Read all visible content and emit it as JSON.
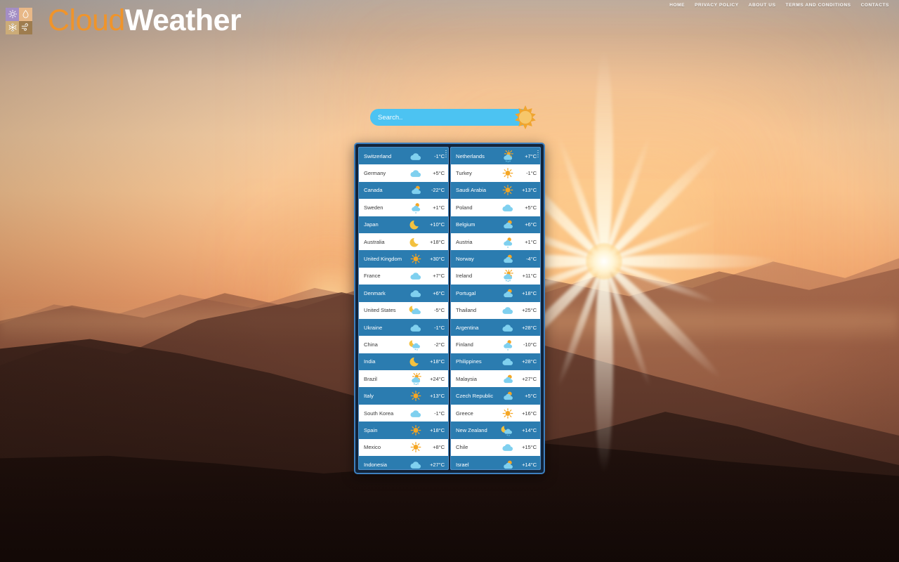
{
  "brand": {
    "part1": "Cloud",
    "part2": "Weather",
    "accent_color": "#f0942a"
  },
  "logo": {
    "cells": [
      {
        "name": "sun-icon",
        "color": "#a48ec4"
      },
      {
        "name": "droplet-icon",
        "color": "#e8b887"
      },
      {
        "name": "snowflake-icon",
        "color": "#ccac78"
      },
      {
        "name": "wind-icon",
        "color": "#9e7c4e"
      }
    ]
  },
  "nav": {
    "items": [
      {
        "label": "HOME"
      },
      {
        "label": "PRIVACY POLICY"
      },
      {
        "label": "ABOUT US"
      },
      {
        "label": "TERMS AND CONDITIONS"
      },
      {
        "label": "CONTACTS"
      }
    ]
  },
  "search": {
    "placeholder": "Search..",
    "value": "",
    "button_icon": "sun-icon",
    "field_color": "#4cc3f2",
    "button_color": "#f2a93b"
  },
  "panel": {
    "border_color": "#3d7fbf",
    "background_color": "#12243a",
    "row_odd_color": "#2b7cb0",
    "row_even_color": "#ffffff",
    "left_column": [
      {
        "country": "Switzerland",
        "temp": "-1°C",
        "icon": "cloud"
      },
      {
        "country": "Germany",
        "temp": "+5°C",
        "icon": "cloud"
      },
      {
        "country": "Canada",
        "temp": "-22°C",
        "icon": "sun-cloud"
      },
      {
        "country": "Sweden",
        "temp": "+1°C",
        "icon": "sun-cloud-snow"
      },
      {
        "country": "Japan",
        "temp": "+10°C",
        "icon": "moon"
      },
      {
        "country": "Australia",
        "temp": "+18°C",
        "icon": "moon"
      },
      {
        "country": "United Kingdom",
        "temp": "+30°C",
        "icon": "sun"
      },
      {
        "country": "France",
        "temp": "+7°C",
        "icon": "cloud"
      },
      {
        "country": "Denmark",
        "temp": "+6°C",
        "icon": "cloud"
      },
      {
        "country": "United States",
        "temp": "-5°C",
        "icon": "moon-cloud"
      },
      {
        "country": "Ukraine",
        "temp": "-1°C",
        "icon": "cloud"
      },
      {
        "country": "China",
        "temp": "-2°C",
        "icon": "moon-cloud-rain"
      },
      {
        "country": "India",
        "temp": "+18°C",
        "icon": "moon"
      },
      {
        "country": "Brazil",
        "temp": "+24°C",
        "icon": "sun-cloud-rain"
      },
      {
        "country": "Italy",
        "temp": "+13°C",
        "icon": "sun"
      },
      {
        "country": "South Korea",
        "temp": "-1°C",
        "icon": "cloud"
      },
      {
        "country": "Spain",
        "temp": "+18°C",
        "icon": "sun"
      },
      {
        "country": "Mexico",
        "temp": "+8°C",
        "icon": "sun"
      },
      {
        "country": "Indonesia",
        "temp": "+27°C",
        "icon": "cloud"
      }
    ],
    "right_column": [
      {
        "country": "Netherlands",
        "temp": "+7°C",
        "icon": "sun-cloud-rain"
      },
      {
        "country": "Turkey",
        "temp": "-1°C",
        "icon": "sun"
      },
      {
        "country": "Saudi Arabia",
        "temp": "+13°C",
        "icon": "sun"
      },
      {
        "country": "Poland",
        "temp": "+5°C",
        "icon": "cloud"
      },
      {
        "country": "Belgium",
        "temp": "+6°C",
        "icon": "sun-cloud"
      },
      {
        "country": "Austria",
        "temp": "+1°C",
        "icon": "sun-cloud-snow"
      },
      {
        "country": "Norway",
        "temp": "-4°C",
        "icon": "sun-cloud"
      },
      {
        "country": "Ireland",
        "temp": "+11°C",
        "icon": "sun-cloud-rain"
      },
      {
        "country": "Portugal",
        "temp": "+18°C",
        "icon": "sun-cloud"
      },
      {
        "country": "Thailand",
        "temp": "+25°C",
        "icon": "cloud"
      },
      {
        "country": "Argentina",
        "temp": "+28°C",
        "icon": "cloud"
      },
      {
        "country": "Finland",
        "temp": "-10°C",
        "icon": "sun-cloud-snow"
      },
      {
        "country": "Philippines",
        "temp": "+28°C",
        "icon": "cloud"
      },
      {
        "country": "Malaysia",
        "temp": "+27°C",
        "icon": "sun-cloud"
      },
      {
        "country": "Czech Republic",
        "temp": "+5°C",
        "icon": "sun-cloud"
      },
      {
        "country": "Greece",
        "temp": "+16°C",
        "icon": "sun"
      },
      {
        "country": "New Zealand",
        "temp": "+14°C",
        "icon": "moon-cloud-rain"
      },
      {
        "country": "Chile",
        "temp": "+15°C",
        "icon": "cloud"
      },
      {
        "country": "Israel",
        "temp": "+14°C",
        "icon": "sun-cloud"
      }
    ]
  }
}
